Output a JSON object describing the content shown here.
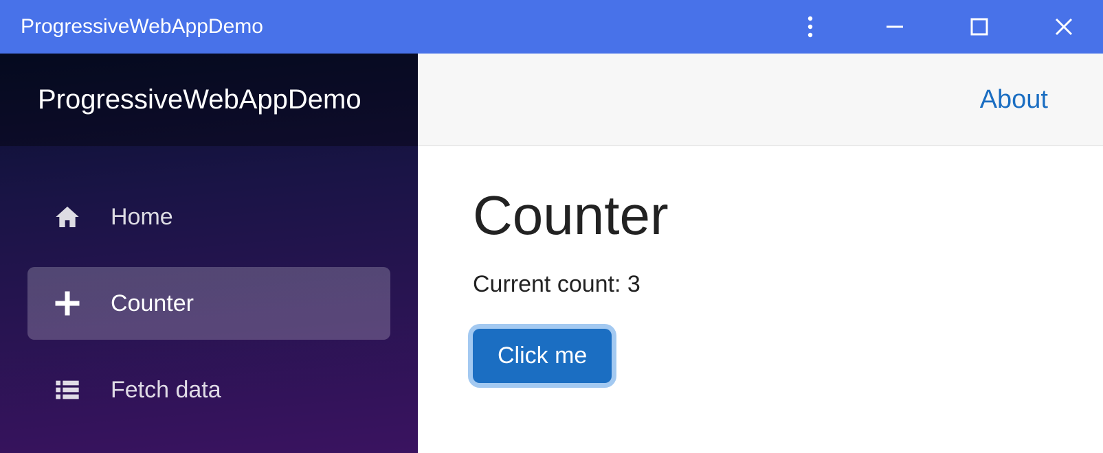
{
  "window": {
    "title": "ProgressiveWebAppDemo"
  },
  "sidebar": {
    "brand": "ProgressiveWebAppDemo",
    "items": [
      {
        "label": "Home",
        "icon": "home",
        "active": false
      },
      {
        "label": "Counter",
        "icon": "plus",
        "active": true
      },
      {
        "label": "Fetch data",
        "icon": "list",
        "active": false
      }
    ]
  },
  "topbar": {
    "about_label": "About"
  },
  "page": {
    "heading": "Counter",
    "count_label": "Current count: 3",
    "button_label": "Click me"
  }
}
